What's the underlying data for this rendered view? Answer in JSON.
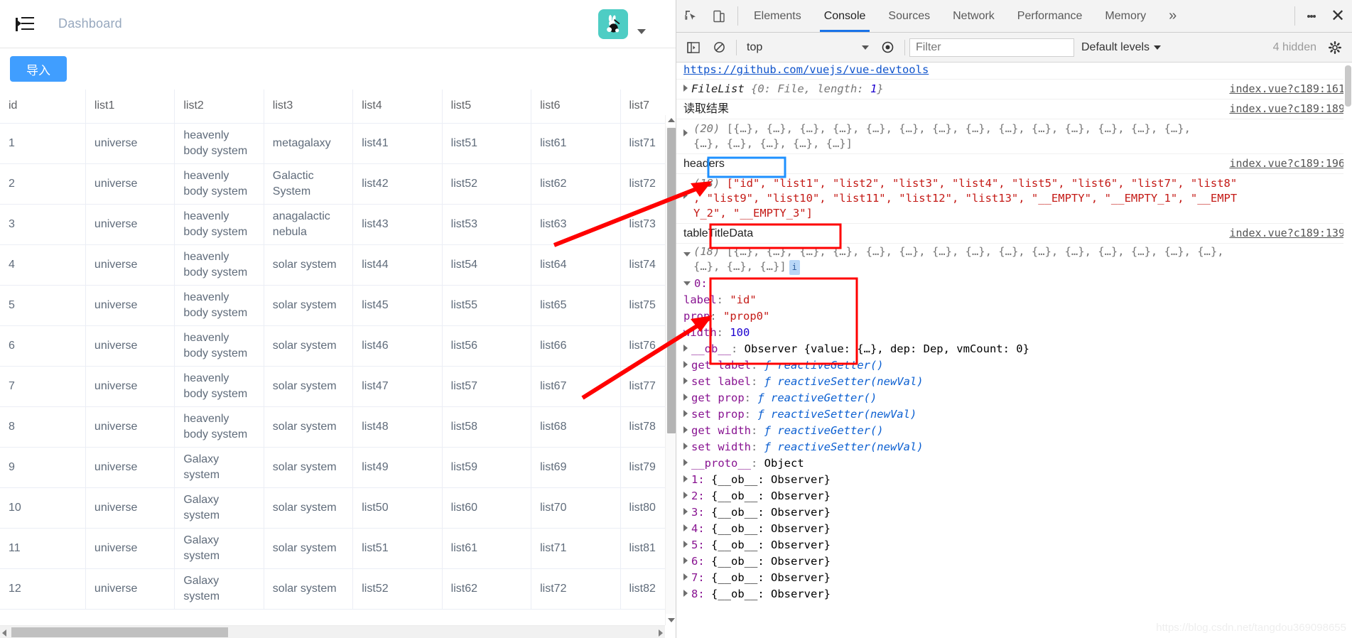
{
  "app": {
    "breadcrumb": "Dashboard",
    "menu_icon": "indent-menu-icon",
    "avatar_icon": "rabbit-avatar-icon",
    "import_button": "导入",
    "accent_color": "#409eff",
    "avatar_color": "#4ecdc4"
  },
  "table": {
    "columns": [
      "id",
      "list1",
      "list2",
      "list3",
      "list4",
      "list5",
      "list6",
      "list7"
    ],
    "rows": [
      [
        "1",
        "universe",
        "heavenly body system",
        "metagalaxy",
        "list41",
        "list51",
        "list61",
        "list71"
      ],
      [
        "2",
        "universe",
        "heavenly body system",
        "Galactic System",
        "list42",
        "list52",
        "list62",
        "list72"
      ],
      [
        "3",
        "universe",
        "heavenly body system",
        "anagalactic nebula",
        "list43",
        "list53",
        "list63",
        "list73"
      ],
      [
        "4",
        "universe",
        "heavenly body system",
        "solar system",
        "list44",
        "list54",
        "list64",
        "list74"
      ],
      [
        "5",
        "universe",
        "heavenly body system",
        "solar system",
        "list45",
        "list55",
        "list65",
        "list75"
      ],
      [
        "6",
        "universe",
        "heavenly body system",
        "solar system",
        "list46",
        "list56",
        "list66",
        "list76"
      ],
      [
        "7",
        "universe",
        "heavenly body system",
        "solar system",
        "list47",
        "list57",
        "list67",
        "list77"
      ],
      [
        "8",
        "universe",
        "heavenly body system",
        "solar system",
        "list48",
        "list58",
        "list68",
        "list78"
      ],
      [
        "9",
        "universe",
        "Galaxy system",
        "solar system",
        "list49",
        "list59",
        "list69",
        "list79"
      ],
      [
        "10",
        "universe",
        "Galaxy system",
        "solar system",
        "list50",
        "list60",
        "list70",
        "list80"
      ],
      [
        "11",
        "universe",
        "Galaxy system",
        "solar system",
        "list51",
        "list61",
        "list71",
        "list81"
      ],
      [
        "12",
        "universe",
        "Galaxy system",
        "solar system",
        "list52",
        "list62",
        "list72",
        "list82"
      ]
    ]
  },
  "devtools": {
    "tabs": [
      {
        "label": "Elements",
        "active": false
      },
      {
        "label": "Console",
        "active": true
      },
      {
        "label": "Sources",
        "active": false
      },
      {
        "label": "Network",
        "active": false
      },
      {
        "label": "Performance",
        "active": false
      },
      {
        "label": "Memory",
        "active": false
      }
    ],
    "more_tabs_label": "»",
    "close_label": "✕",
    "icons": {
      "inspect": "inspect-element-icon",
      "device": "device-toolbar-icon",
      "sidebar": "console-sidebar-icon",
      "clear": "clear-console-icon",
      "eye": "live-expression-icon",
      "settings": "gear-icon",
      "kebab": "more-options-icon"
    },
    "filterbar": {
      "context": "top",
      "filter_placeholder": "Filter",
      "levels": "Default levels",
      "hidden": "4 hidden"
    },
    "console": {
      "top_partial_link": "https://github.com/vuejs/vue-devtools",
      "messages": [
        {
          "id": "filelist",
          "text_class": "FileList",
          "preview_open": "{0: File, length: ",
          "preview_num": "1",
          "preview_close": "}",
          "source": "index.vue?c189:161"
        },
        {
          "id": "read-result-label",
          "label": "读取结果",
          "source": "index.vue?c189:189"
        },
        {
          "id": "read-result-array",
          "count": "(20)",
          "line1": "[{…}, {…}, {…}, {…}, {…}, {…}, {…}, {…}, {…}, {…}, {…}, {…}, {…}, {…},",
          "line2": "{…}, {…}, {…}, {…}, {…}]"
        },
        {
          "id": "headers-label",
          "label": "headers",
          "source": "index.vue?c189:196"
        },
        {
          "id": "headers-array",
          "count": "(18)",
          "line1": "[\"id\", \"list1\", \"list2\", \"list3\", \"list4\", \"list5\", \"list6\", \"list7\", \"list8\"",
          "line2": ", \"list9\", \"list10\", \"list11\", \"list12\", \"list13\", \"__EMPTY\", \"__EMPTY_1\", \"__EMPT",
          "line3": "Y_2\", \"__EMPTY_3\"]"
        },
        {
          "id": "tabletitledata-label",
          "label": "tableTitleData",
          "source": "index.vue?c189:139"
        },
        {
          "id": "tabletitledata-array",
          "count": "(18)",
          "line1": "[{…}, {…}, {…}, {…}, {…}, {…}, {…}, {…}, {…}, {…}, {…}, {…}, {…}, {…}, {…},",
          "line2": "{…}, {…}, {…}]",
          "badge": "i"
        }
      ],
      "expanded_object": {
        "index_label": "0:",
        "props": [
          {
            "key": "label",
            "value": "\"id\"",
            "type": "string"
          },
          {
            "key": "prop",
            "value": "\"prop0\"",
            "type": "string"
          },
          {
            "key": "width",
            "value": "100",
            "type": "number"
          }
        ],
        "observer_line": {
          "key": "__ob__",
          "value": "Observer {value: {…}, dep: Dep, vmCount: 0}"
        },
        "accessors": [
          {
            "kind": "get",
            "key": "label",
            "fn": "ƒ reactiveGetter()"
          },
          {
            "kind": "set",
            "key": "label",
            "fn": "ƒ reactiveSetter(newVal)"
          },
          {
            "kind": "get",
            "key": "prop",
            "fn": "ƒ reactiveGetter()"
          },
          {
            "kind": "set",
            "key": "prop",
            "fn": "ƒ reactiveSetter(newVal)"
          },
          {
            "kind": "get",
            "key": "width",
            "fn": "ƒ reactiveGetter()"
          },
          {
            "kind": "set",
            "key": "width",
            "fn": "ƒ reactiveSetter(newVal)"
          }
        ],
        "proto_line": {
          "key": "__proto__",
          "value": "Object"
        }
      },
      "observer_items": [
        {
          "index": "1:",
          "value": "{__ob__: Observer}"
        },
        {
          "index": "2:",
          "value": "{__ob__: Observer}"
        },
        {
          "index": "3:",
          "value": "{__ob__: Observer}"
        },
        {
          "index": "4:",
          "value": "{__ob__: Observer}"
        },
        {
          "index": "5:",
          "value": "{__ob__: Observer}"
        },
        {
          "index": "6:",
          "value": "{__ob__: Observer}"
        },
        {
          "index": "7:",
          "value": "{__ob__: Observer}"
        },
        {
          "index": "8:",
          "value": "{__ob__: Observer}"
        }
      ]
    }
  },
  "annotations": {
    "highlight_headers": "headers",
    "highlight_tabletitledata": "tableTitleData",
    "highlight_object": "0: label/prop/width",
    "blue_color": "#1e90ff",
    "red_color": "#ff0000"
  },
  "watermark": "https://blog.csdn.net/tangdou369098655"
}
